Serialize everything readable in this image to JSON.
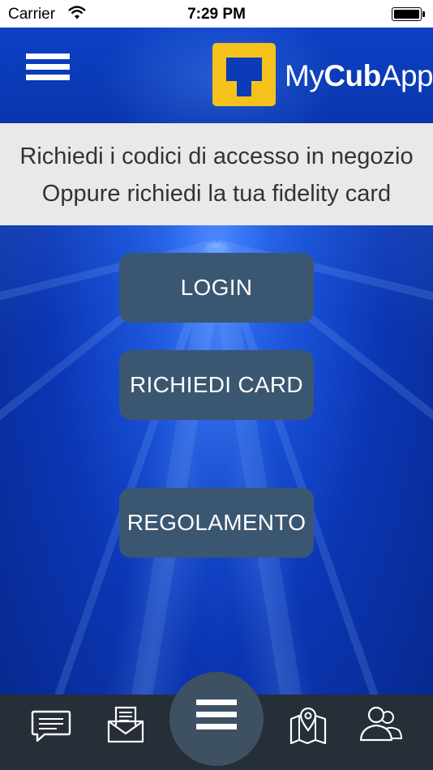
{
  "status_bar": {
    "carrier": "Carrier",
    "time": "7:29 PM"
  },
  "header": {
    "menu_icon": "hamburger-menu-icon",
    "logo": {
      "text_regular_1": "My",
      "text_bold": "Cub",
      "text_regular_2": "App",
      "mark_color": "#f5c21b"
    }
  },
  "info": {
    "line1": "Richiedi i codici di accesso in negozio",
    "line2": "Oppure richiedi la tua fidelity card"
  },
  "buttons": {
    "login": "LOGIN",
    "request_card": "RICHIEDI CARD",
    "rules": "REGOLAMENTO"
  },
  "tabbar": {
    "items": [
      {
        "icon": "chat-bubble-icon"
      },
      {
        "icon": "mail-inbox-icon"
      },
      {
        "icon": "menu-icon"
      },
      {
        "icon": "map-pin-icon"
      },
      {
        "icon": "users-icon"
      }
    ]
  },
  "colors": {
    "button_bg": "#3b5670",
    "tabbar_bg": "#262e37",
    "info_bg": "#e9e9e9",
    "accent_yellow": "#f5c21b"
  }
}
